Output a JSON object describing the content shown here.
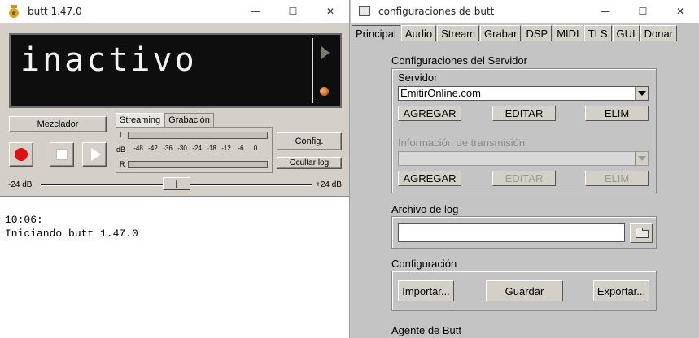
{
  "butt_window": {
    "title": "butt 1.47.0",
    "status_text": "inactivo",
    "mixer_label": "Mezclador",
    "tabs": [
      "Streaming",
      "Grabación"
    ],
    "vu": {
      "left_label": "L",
      "db_label": "dB",
      "right_label": "R",
      "ticks": [
        "-48",
        "-42",
        "-36",
        "-30",
        "-24",
        "-18",
        "-12",
        "-6",
        "0"
      ]
    },
    "config_label": "Config.",
    "hide_log_label": "Ocultar log",
    "slider_min_label": "-24 dB",
    "slider_max_label": "+24 dB",
    "slider_value_fraction": 0.5,
    "log_lines": [
      "10:06:",
      "Iniciando butt 1.47.0"
    ]
  },
  "config_window": {
    "title": "configuraciones de butt",
    "tabs": [
      "Principal",
      "Audio",
      "Stream",
      "Grabar",
      "DSP",
      "MIDI",
      "TLS",
      "GUI",
      "Donar"
    ],
    "active_tab": "Principal",
    "server_section": {
      "title": "Configuraciones del Servidor",
      "server_label": "Servidor",
      "server_value": "EmitirOnline.com",
      "add_label": "AGREGAR",
      "edit_label": "EDITAR",
      "delete_label": "ELIM",
      "stream_info_label": "Información de transmisión",
      "stream_info_value": "",
      "add2_label": "AGREGAR",
      "edit2_label": "EDITAR",
      "delete2_label": "ELIM"
    },
    "log_section": {
      "title": "Archivo de log",
      "path_value": ""
    },
    "config_section": {
      "title": "Configuración",
      "import_label": "Importar...",
      "save_label": "Guardar",
      "export_label": "Exportar..."
    },
    "agent_section": {
      "title": "Agente de Butt"
    }
  },
  "window_controls": {
    "minimize": "—",
    "maximize": "☐",
    "close": "✕"
  }
}
